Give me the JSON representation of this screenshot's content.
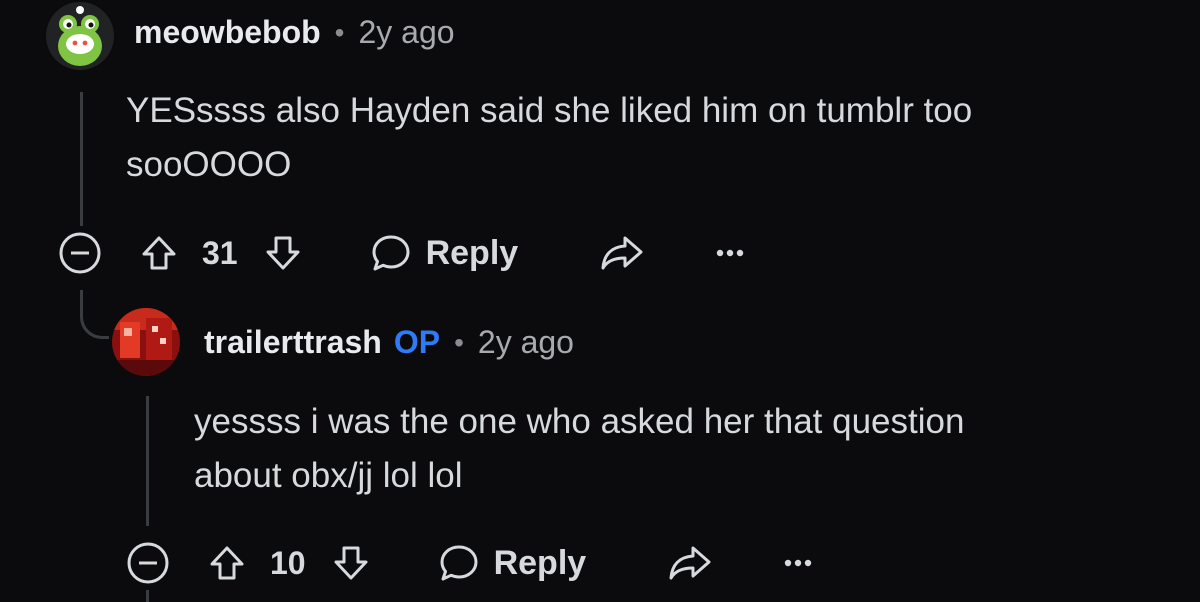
{
  "comments": [
    {
      "username": "meowbebob",
      "separator": "•",
      "time": "2y ago",
      "body_line1": "YESssss also Hayden said she liked him on tumblr too",
      "body_line2": "sooOOOO",
      "votes": "31",
      "reply_label": "Reply",
      "avatar_icon": "snoo-frog-avatar",
      "collapse_icon": "collapse-minus-icon",
      "upvote_icon": "upvote-arrow-icon",
      "downvote_icon": "downvote-arrow-icon",
      "reply_icon": "speech-bubble-icon",
      "share_icon": "share-arrow-icon",
      "more_icon": "more-dots-icon"
    },
    {
      "username": "trailerttrash",
      "op_badge": "OP",
      "separator": "•",
      "time": "2y ago",
      "body_line1": "yessss i was the one who asked her that question",
      "body_line2": "about obx/jj lol lol",
      "votes": "10",
      "reply_label": "Reply",
      "avatar_icon": "red-photo-avatar"
    }
  ],
  "colors": {
    "background": "#0b0b0d",
    "op_badge": "#2f7bf5",
    "text": "#d7dadc",
    "thread_line": "#3a3d40"
  }
}
